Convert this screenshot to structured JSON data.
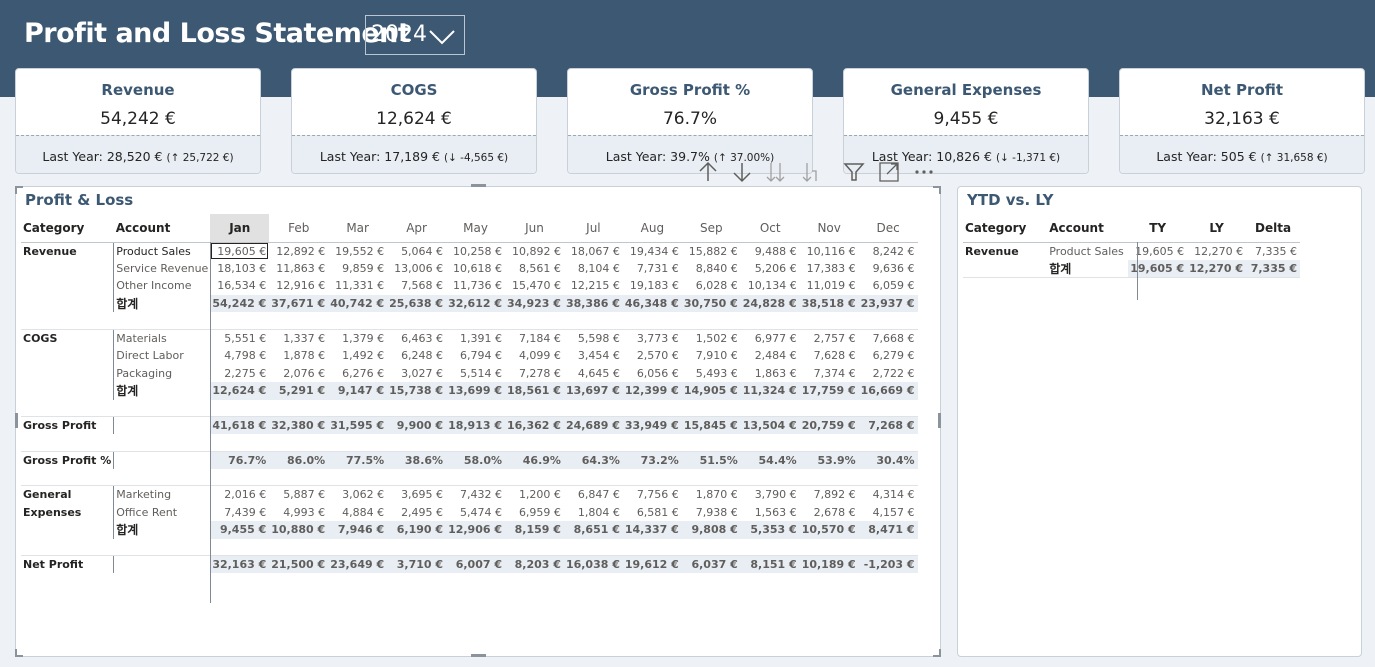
{
  "header": {
    "title": "Profit and Loss Statement",
    "year": "2024"
  },
  "kpis": [
    {
      "title": "Revenue",
      "value": "54,242 €",
      "last_year": "Last Year: 28,520 €",
      "delta": "(↑ 25,722 €)"
    },
    {
      "title": "COGS",
      "value": "12,624 €",
      "last_year": "Last Year: 17,189 €",
      "delta": "(↓ -4,565 €)"
    },
    {
      "title": "Gross Profit %",
      "value": "76.7%",
      "last_year": "Last Year: 39.7%",
      "delta": "(↑ 37.00%)"
    },
    {
      "title": "General Expenses",
      "value": "9,455 €",
      "last_year": "Last Year: 10,826 €",
      "delta": "(↓ -1,371 €)"
    },
    {
      "title": "Net Profit",
      "value": "32,163 €",
      "last_year": "Last Year: 505 €",
      "delta": "(↑ 31,658 €)"
    }
  ],
  "pl": {
    "title": "Profit & Loss",
    "col_category": "Category",
    "col_account": "Account",
    "months": [
      "Jan",
      "Feb",
      "Mar",
      "Apr",
      "May",
      "Jun",
      "Jul",
      "Aug",
      "Sep",
      "Oct",
      "Nov",
      "Dec"
    ],
    "rows": [
      {
        "category": "Revenue",
        "account": "Product Sales",
        "values": [
          "19,605 €",
          "12,892 €",
          "19,552 €",
          "5,064 €",
          "10,258 €",
          "10,892 €",
          "18,067 €",
          "19,434 €",
          "15,882 €",
          "9,488 €",
          "10,116 €",
          "8,242 €"
        ]
      },
      {
        "category": "",
        "account": "Service Revenue",
        "values": [
          "18,103 €",
          "11,863 €",
          "9,859 €",
          "13,006 €",
          "10,618 €",
          "8,561 €",
          "8,104 €",
          "7,731 €",
          "8,840 €",
          "5,206 €",
          "17,383 €",
          "9,636 €"
        ]
      },
      {
        "category": "",
        "account": "Other Income",
        "values": [
          "16,534 €",
          "12,916 €",
          "11,331 €",
          "7,568 €",
          "11,736 €",
          "15,470 €",
          "12,215 €",
          "19,183 €",
          "6,028 €",
          "10,134 €",
          "11,019 €",
          "6,059 €"
        ]
      },
      {
        "category": "",
        "account": "합계",
        "total": true,
        "values": [
          "54,242 €",
          "37,671 €",
          "40,742 €",
          "25,638 €",
          "32,612 €",
          "34,923 €",
          "38,386 €",
          "46,348 €",
          "30,750 €",
          "24,828 €",
          "38,518 €",
          "23,937 €"
        ]
      },
      {
        "spacer": true
      },
      {
        "category": "COGS",
        "account": "Materials",
        "values": [
          "5,551 €",
          "1,337 €",
          "1,379 €",
          "6,463 €",
          "1,391 €",
          "7,184 €",
          "5,598 €",
          "3,773 €",
          "1,502 €",
          "6,977 €",
          "2,757 €",
          "7,668 €"
        ]
      },
      {
        "category": "",
        "account": "Direct Labor",
        "values": [
          "4,798 €",
          "1,878 €",
          "1,492 €",
          "6,248 €",
          "6,794 €",
          "4,099 €",
          "3,454 €",
          "2,570 €",
          "7,910 €",
          "2,484 €",
          "7,628 €",
          "6,279 €"
        ]
      },
      {
        "category": "",
        "account": "Packaging",
        "values": [
          "2,275 €",
          "2,076 €",
          "6,276 €",
          "3,027 €",
          "5,514 €",
          "7,278 €",
          "4,645 €",
          "6,056 €",
          "5,493 €",
          "1,863 €",
          "7,374 €",
          "2,722 €"
        ]
      },
      {
        "category": "",
        "account": "합계",
        "total": true,
        "values": [
          "12,624 €",
          "5,291 €",
          "9,147 €",
          "15,738 €",
          "13,699 €",
          "18,561 €",
          "13,697 €",
          "12,399 €",
          "14,905 €",
          "11,324 €",
          "17,759 €",
          "16,669 €"
        ]
      },
      {
        "spacer": true
      },
      {
        "category": "Gross Profit",
        "account": "",
        "total": true,
        "values": [
          "41,618 €",
          "32,380 €",
          "31,595 €",
          "9,900 €",
          "18,913 €",
          "16,362 €",
          "24,689 €",
          "33,949 €",
          "15,845 €",
          "13,504 €",
          "20,759 €",
          "7,268 €"
        ]
      },
      {
        "spacer": true
      },
      {
        "category": "Gross Profit %",
        "account": "",
        "total": true,
        "values": [
          "76.7%",
          "86.0%",
          "77.5%",
          "38.6%",
          "58.0%",
          "46.9%",
          "64.3%",
          "73.2%",
          "51.5%",
          "54.4%",
          "53.9%",
          "30.4%"
        ]
      },
      {
        "spacer": true
      },
      {
        "category": "General",
        "account": "Marketing",
        "values": [
          "2,016 €",
          "5,887 €",
          "3,062 €",
          "3,695 €",
          "7,432 €",
          "1,200 €",
          "6,847 €",
          "7,756 €",
          "1,870 €",
          "3,790 €",
          "7,892 €",
          "4,314 €"
        ]
      },
      {
        "category": "Expenses",
        "account": "Office Rent",
        "values": [
          "7,439 €",
          "4,993 €",
          "4,884 €",
          "2,495 €",
          "5,474 €",
          "6,959 €",
          "1,804 €",
          "6,581 €",
          "7,938 €",
          "1,563 €",
          "2,678 €",
          "4,157 €"
        ]
      },
      {
        "category": "",
        "account": "합계",
        "total": true,
        "values": [
          "9,455 €",
          "10,880 €",
          "7,946 €",
          "6,190 €",
          "12,906 €",
          "8,159 €",
          "8,651 €",
          "14,337 €",
          "9,808 €",
          "5,353 €",
          "10,570 €",
          "8,471 €"
        ]
      },
      {
        "spacer": true
      },
      {
        "category": "Net Profit",
        "account": "",
        "total": true,
        "values": [
          "32,163 €",
          "21,500 €",
          "23,649 €",
          "3,710 €",
          "6,007 €",
          "8,203 €",
          "16,038 €",
          "19,612 €",
          "6,037 €",
          "8,151 €",
          "10,189 €",
          "-1,203 €"
        ]
      }
    ]
  },
  "ytd": {
    "title": "YTD vs. LY",
    "columns": [
      "Category",
      "Account",
      "TY",
      "LY",
      "Delta"
    ],
    "rows": [
      {
        "category": "Revenue",
        "account": "Product Sales",
        "values": [
          "19,605 €",
          "12,270 €",
          "7,335 €"
        ]
      },
      {
        "category": "",
        "account": "합계",
        "total": true,
        "values": [
          "19,605 €",
          "12,270 €",
          "7,335 €"
        ]
      }
    ]
  },
  "icons": [
    "arrow-up-icon",
    "arrow-down-icon",
    "expand-all-down-icon",
    "drill-down-icon",
    "filter-icon",
    "focus-mode-icon",
    "more-options-icon",
    "chevron-down-icon"
  ]
}
